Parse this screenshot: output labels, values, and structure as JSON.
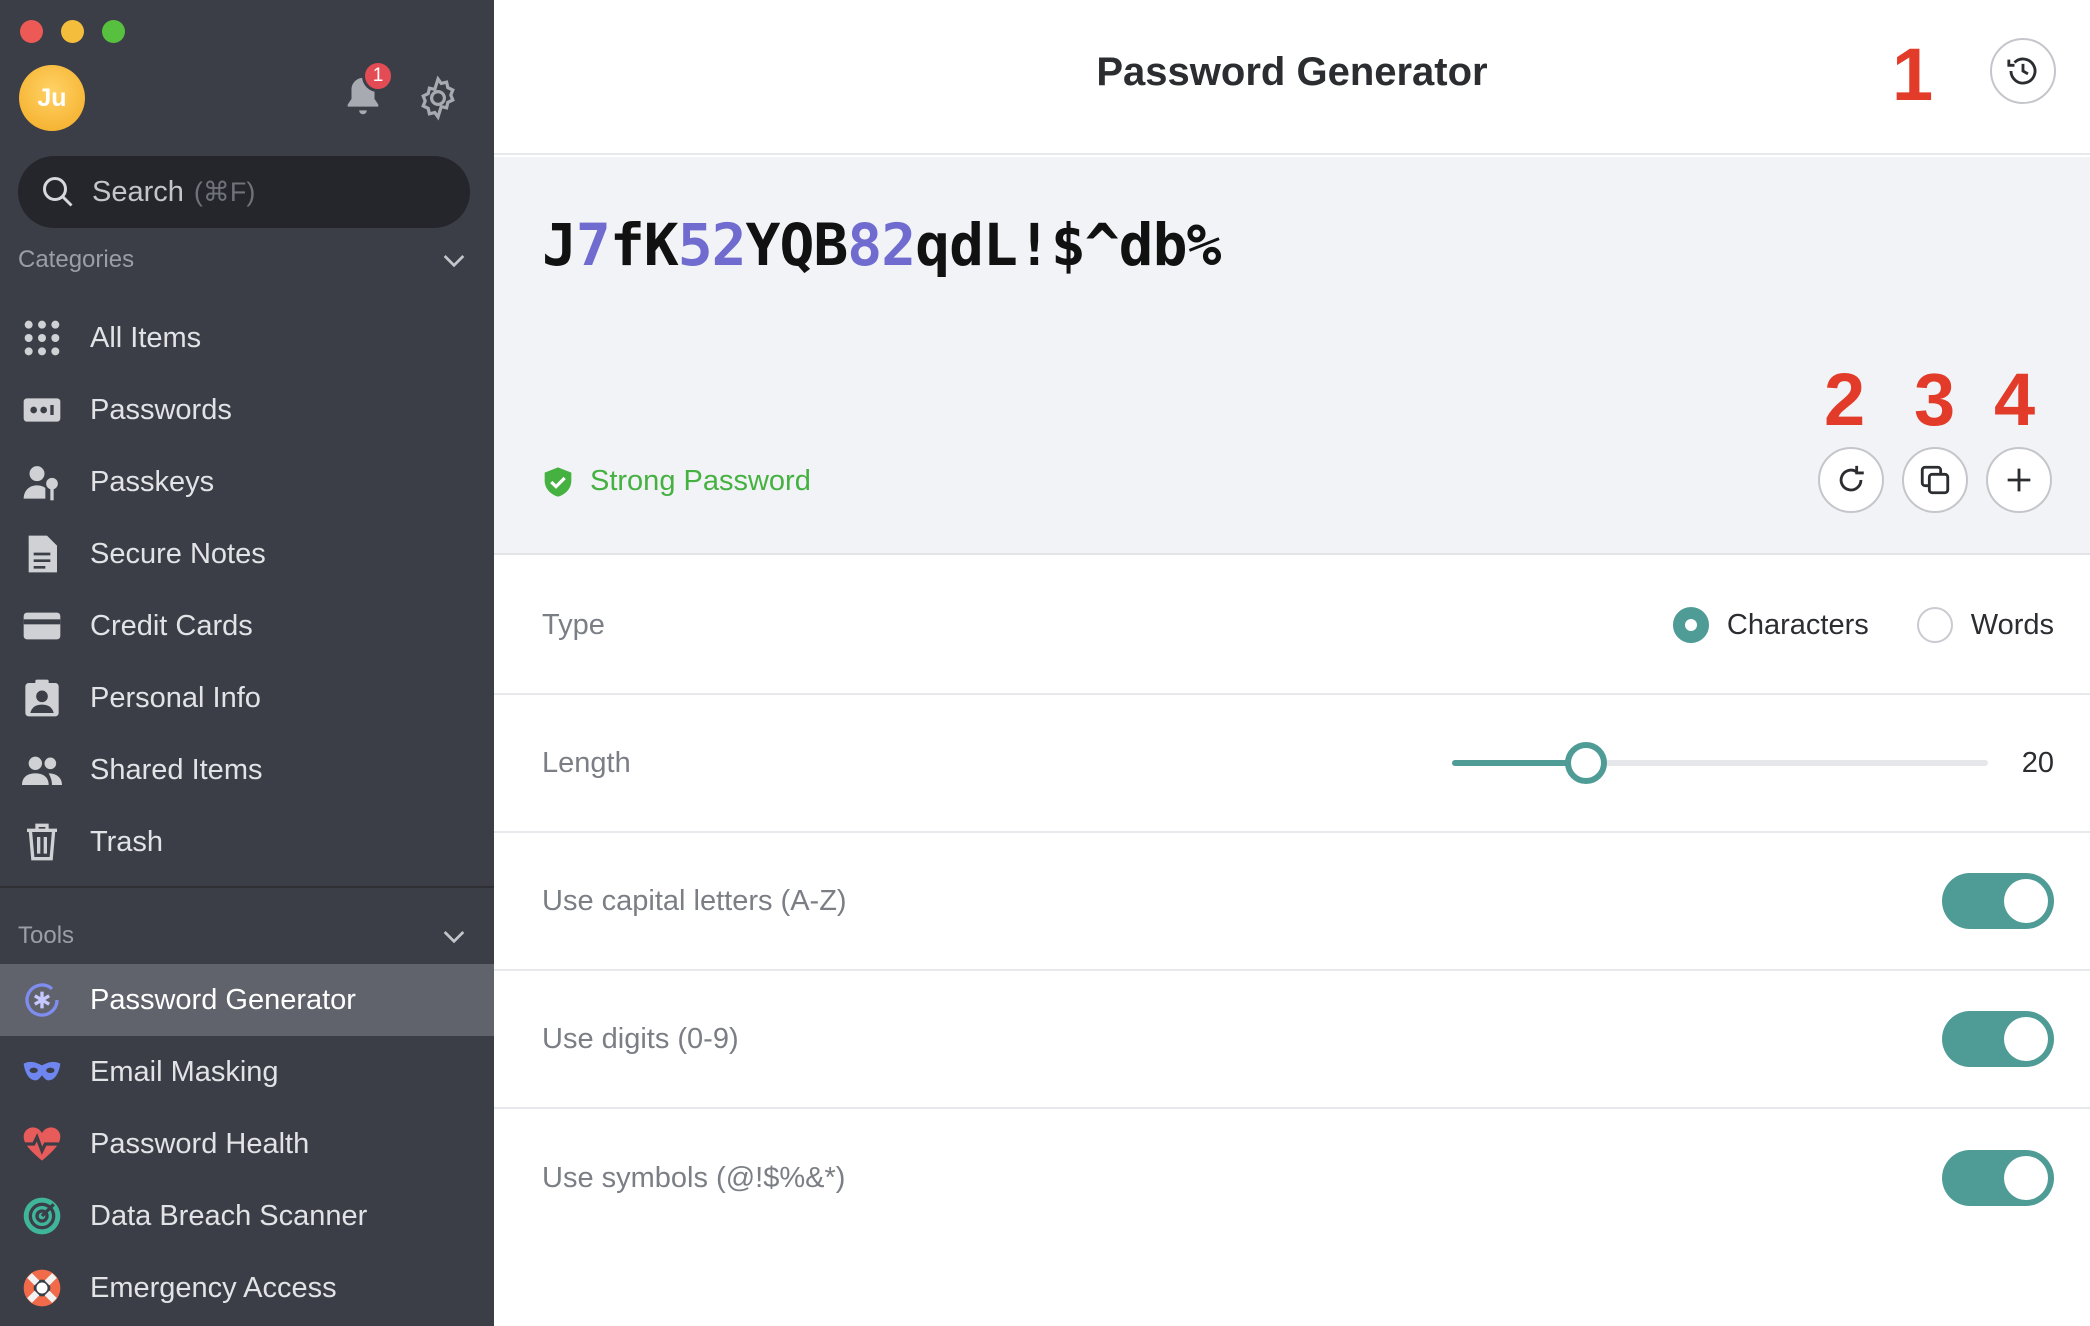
{
  "sidebar": {
    "avatar_initials": "Ju",
    "notification_count": "1",
    "search": {
      "label": "Search",
      "shortcut": "(⌘F)"
    },
    "categories_heading": "Categories",
    "categories": [
      {
        "label": "All Items",
        "icon": "grid-icon"
      },
      {
        "label": "Passwords",
        "icon": "password-icon"
      },
      {
        "label": "Passkeys",
        "icon": "passkey-icon"
      },
      {
        "label": "Secure Notes",
        "icon": "note-icon"
      },
      {
        "label": "Credit Cards",
        "icon": "credit-card-icon"
      },
      {
        "label": "Personal Info",
        "icon": "id-badge-icon"
      },
      {
        "label": "Shared Items",
        "icon": "people-icon"
      },
      {
        "label": "Trash",
        "icon": "trash-icon"
      }
    ],
    "tools_heading": "Tools",
    "tools": [
      {
        "label": "Password Generator",
        "icon": "password-generator-icon",
        "active": true
      },
      {
        "label": "Email Masking",
        "icon": "mask-icon"
      },
      {
        "label": "Password Health",
        "icon": "heart-pulse-icon"
      },
      {
        "label": "Data Breach Scanner",
        "icon": "radar-icon"
      },
      {
        "label": "Emergency Access",
        "icon": "lifebuoy-icon"
      }
    ]
  },
  "main": {
    "title": "Password Generator",
    "annotations": [
      "1",
      "2",
      "3",
      "4"
    ],
    "password": "J7fK52YQB82qdL!$^db%",
    "strength_label": "Strong Password",
    "type": {
      "label": "Type",
      "options": [
        "Characters",
        "Words"
      ],
      "selected": "Characters"
    },
    "length": {
      "label": "Length",
      "value": "20",
      "min": 0,
      "max": 100,
      "fraction": 0.25
    },
    "options": [
      {
        "label": "Use capital letters (A-Z)",
        "on": true
      },
      {
        "label": "Use digits (0-9)",
        "on": true
      },
      {
        "label": "Use symbols (@!$%&*)",
        "on": true
      }
    ]
  },
  "colors": {
    "accent": "#4f9b96",
    "digit": "#6f6bcf",
    "strong": "#45b140",
    "annotation": "#e23b2a"
  }
}
